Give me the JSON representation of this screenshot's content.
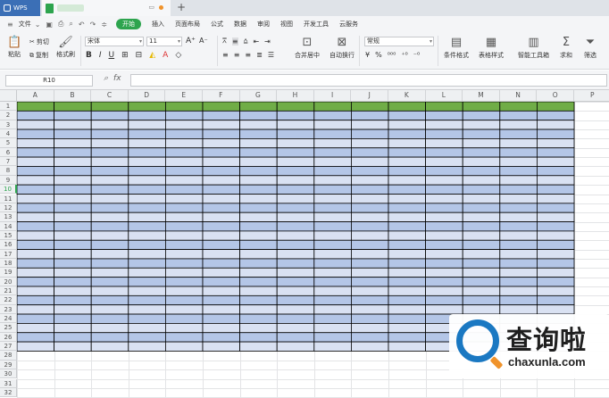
{
  "titlebar": {
    "app_tab": "WPS",
    "add_tab": "+"
  },
  "menu": {
    "file": "文件",
    "items": [
      "开始",
      "插入",
      "页面布局",
      "公式",
      "数据",
      "审阅",
      "视图",
      "开发工具",
      "云服务"
    ],
    "active_index": 0
  },
  "ribbon": {
    "paste": "粘贴",
    "cut": "剪切",
    "copy": "复制",
    "format_painter": "格式刷",
    "font_name": "宋体",
    "font_size": "11",
    "merge_center": "合并居中",
    "wrap_text": "自动换行",
    "number_format": "常规",
    "cond_format": "条件格式",
    "table_style": "表格样式",
    "smart_toolbox": "智能工具箱",
    "sum": "求和",
    "filter": "筛选"
  },
  "formula_bar": {
    "cell_ref": "R10",
    "fx": "fx",
    "value": ""
  },
  "grid": {
    "columns": [
      "A",
      "B",
      "C",
      "D",
      "E",
      "F",
      "G",
      "H",
      "I",
      "J",
      "K",
      "L",
      "M",
      "N",
      "O",
      "P"
    ],
    "rows": [
      "1",
      "2",
      "3",
      "4",
      "5",
      "6",
      "7",
      "8",
      "9",
      "10",
      "11",
      "12",
      "13",
      "14",
      "15",
      "16",
      "17",
      "18",
      "19",
      "20",
      "21",
      "22",
      "23",
      "24",
      "25",
      "26",
      "27",
      "28",
      "29",
      "30",
      "31",
      "32"
    ],
    "active_row": "10",
    "table": {
      "header_row": "1",
      "last_row": "27",
      "first_col": "A",
      "last_col": "O"
    },
    "colors": {
      "header_fill": "#70ad47",
      "odd_band": "#b4c6e7",
      "even_band": "#d9e1f2",
      "border": "#000000"
    }
  },
  "watermark": {
    "cn": "查询啦",
    "en": "chaxunla.com"
  }
}
